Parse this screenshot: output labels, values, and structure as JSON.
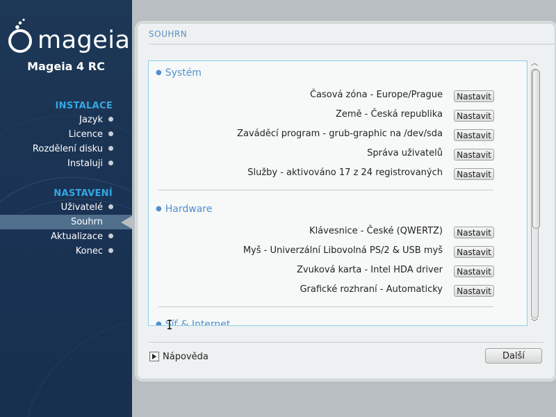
{
  "sidebar": {
    "logo_text": "mageia",
    "product": "Mageia 4 RC",
    "sections": [
      {
        "title": "INSTALACE",
        "steps": [
          "Jazyk",
          "Licence",
          "Rozdělení disku",
          "Instaluji"
        ]
      },
      {
        "title": "NASTAVENÍ",
        "steps": [
          "Uživatelé",
          "Souhrn",
          "Aktualizace",
          "Konec"
        ]
      }
    ],
    "current_step": "Souhrn"
  },
  "main": {
    "title": "SOUHRN",
    "groups": [
      {
        "title": "Systém",
        "rows": [
          {
            "label": "Časová zóna - Europe/Prague",
            "button": "Nastavit"
          },
          {
            "label": "Země - Česká republika",
            "button": "Nastavit"
          },
          {
            "label": "Zaváděcí program - grub-graphic na /dev/sda",
            "button": "Nastavit"
          },
          {
            "label": "Správa uživatelů",
            "button": "Nastavit"
          },
          {
            "label": "Služby - aktivováno 17 z 24 registrovaných",
            "button": "Nastavit"
          }
        ]
      },
      {
        "title": "Hardware",
        "rows": [
          {
            "label": "Klávesnice - České (QWERTZ)",
            "button": "Nastavit"
          },
          {
            "label": "Myš - Univerzální Libovolná PS/2 & USB myš",
            "button": "Nastavit"
          },
          {
            "label": "Zvuková karta - Intel HDA driver",
            "button": "Nastavit"
          },
          {
            "label": "Grafické rozhraní - Automaticky",
            "button": "Nastavit"
          }
        ]
      },
      {
        "title": "Síť & Internet",
        "rows": []
      }
    ],
    "scroll_fraction": 0.0,
    "help_label": "Nápověda",
    "next_label": "Další"
  },
  "colors": {
    "sidebar_bg": "#1d3756",
    "section_title": "#35a7e2",
    "group_title": "#4f8fcf",
    "current_step_bg": "#4f6f8c"
  },
  "icons": [
    "mageia-logo-icon",
    "expand-triangle-icon",
    "scroll-up-icon",
    "scroll-down-icon",
    "text-cursor-icon"
  ]
}
